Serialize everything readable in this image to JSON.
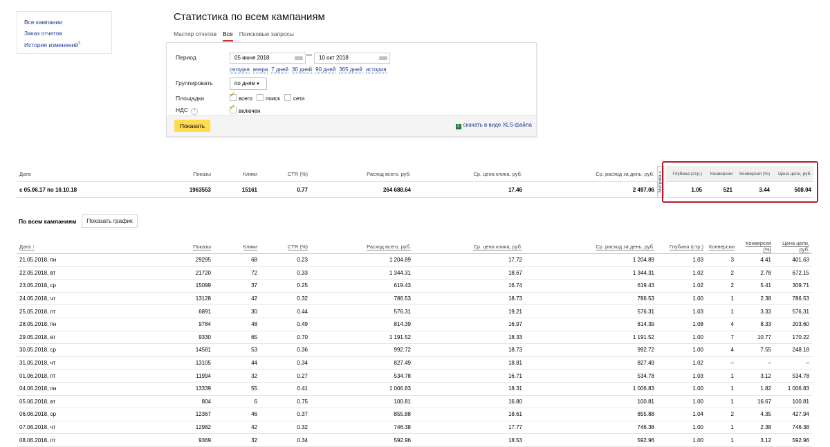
{
  "sidebar": {
    "links": [
      "Все кампании",
      "Заказ отчетов",
      "История изменений"
    ],
    "history_badge": "3"
  },
  "page_title": "Статистика по всем кампаниям",
  "tabs": [
    {
      "label": "Мастер отчетов",
      "active": false
    },
    {
      "label": "Все",
      "active": true
    },
    {
      "label": "Поисковые запросы",
      "active": false
    }
  ],
  "filters": {
    "period_label": "Период",
    "date_from": "05 июня 2018",
    "date_to": "10 окт 2018",
    "quick_periods": [
      "сегодня",
      "вчера",
      "7 дней",
      "30 дней",
      "90 дней",
      "365 дней",
      "история"
    ],
    "group_label": "Группировать",
    "group_value": "по дням",
    "platforms_label": "Площадки",
    "platforms": [
      {
        "label": "всего",
        "checked": true
      },
      {
        "label": "поиск",
        "checked": false
      },
      {
        "label": "сети",
        "checked": false
      }
    ],
    "vat_label": "НДС",
    "vat_option": {
      "label": "включен",
      "checked": true
    },
    "show_button": "Показать",
    "xls_link": "скачать в виде XLS-файла"
  },
  "summary": {
    "headers": [
      "Дата",
      "Показы",
      "Клики",
      "CTR (%)",
      "Расход всего, руб.",
      "Ср. цена клика, руб.",
      "Ср. расход за день, руб."
    ],
    "row": [
      "с 05.06.17 по 10.10.18",
      "1963553",
      "15161",
      "0.77",
      "264 688.64",
      "17.46",
      "2 497.06"
    ],
    "metrika_tab": "Метрика »",
    "metrika_headers": [
      "Глубина (стр.)",
      "Конверсии",
      "Конверсия (%)",
      "Цена цели, руб."
    ],
    "metrika_row": [
      "1.05",
      "521",
      "3.44",
      "508.04"
    ]
  },
  "section": {
    "title": "По всем кампаниям",
    "graph_button": "Показать график"
  },
  "table": {
    "headers": [
      "Дата ↑",
      "Показы",
      "Клики",
      "CTR (%)",
      "Расход всего, руб.",
      "Ср. цена клика, руб.",
      "Ср. расход за день, руб.",
      "Глубина (стр.)",
      "Конверсии",
      "Конверсия (%)",
      "Цена цели, руб."
    ],
    "rows": [
      [
        "21.05.2018, пн",
        "29295",
        "68",
        "0.23",
        "1 204.89",
        "17.72",
        "1 204.89",
        "1.03",
        "3",
        "4.41",
        "401.63"
      ],
      [
        "22.05.2018, вт",
        "21720",
        "72",
        "0.33",
        "1 344.31",
        "18.67",
        "1 344.31",
        "1.02",
        "2",
        "2.78",
        "672.15"
      ],
      [
        "23.05.2018, ср",
        "15099",
        "37",
        "0.25",
        "619.43",
        "16.74",
        "619.43",
        "1.02",
        "2",
        "5.41",
        "309.71"
      ],
      [
        "24.05.2018, чт",
        "13128",
        "42",
        "0.32",
        "786.53",
        "18.73",
        "786.53",
        "1.00",
        "1",
        "2.38",
        "786.53"
      ],
      [
        "25.05.2018, пт",
        "6891",
        "30",
        "0.44",
        "576.31",
        "19.21",
        "576.31",
        "1.03",
        "1",
        "3.33",
        "576.31"
      ],
      [
        "28.05.2018, пн",
        "9784",
        "48",
        "0.49",
        "814.39",
        "16.97",
        "814.39",
        "1.08",
        "4",
        "8.33",
        "203.60"
      ],
      [
        "29.05.2018, вт",
        "9330",
        "65",
        "0.70",
        "1 191.52",
        "18.33",
        "1 191.52",
        "1.00",
        "7",
        "10.77",
        "170.22"
      ],
      [
        "30.05.2018, ср",
        "14581",
        "53",
        "0.36",
        "992.72",
        "18.73",
        "992.72",
        "1.00",
        "4",
        "7.55",
        "248.18"
      ],
      [
        "31.05.2018, чт",
        "13105",
        "44",
        "0.34",
        "827.49",
        "18.81",
        "827.49",
        "1.02",
        "–",
        "–",
        "–"
      ],
      [
        "01.06.2018, пт",
        "11994",
        "32",
        "0.27",
        "534.78",
        "16.71",
        "534.78",
        "1.03",
        "1",
        "3.12",
        "534.78"
      ],
      [
        "04.06.2018, пн",
        "13339",
        "55",
        "0.41",
        "1 006.83",
        "18.31",
        "1 006.83",
        "1.00",
        "1",
        "1.82",
        "1 006.83"
      ],
      [
        "05.06.2018, вт",
        "804",
        "6",
        "0.75",
        "100.81",
        "16.80",
        "100.81",
        "1.00",
        "1",
        "16.67",
        "100.81"
      ],
      [
        "06.06.2018, ср",
        "12367",
        "46",
        "0.37",
        "855.88",
        "18.61",
        "855.88",
        "1.04",
        "2",
        "4.35",
        "427.94"
      ],
      [
        "07.06.2018, чт",
        "12982",
        "42",
        "0.32",
        "746.38",
        "17.77",
        "746.38",
        "1.00",
        "1",
        "2.38",
        "746.38"
      ],
      [
        "08.06.2018, пт",
        "9369",
        "32",
        "0.34",
        "592.96",
        "18.53",
        "592.96",
        "1.00",
        "1",
        "3.12",
        "592.96"
      ]
    ]
  },
  "colors": {
    "accent_yellow": "#ffdb4d",
    "highlight_red": "#b01c26",
    "link_blue": "#1a3d8f"
  }
}
